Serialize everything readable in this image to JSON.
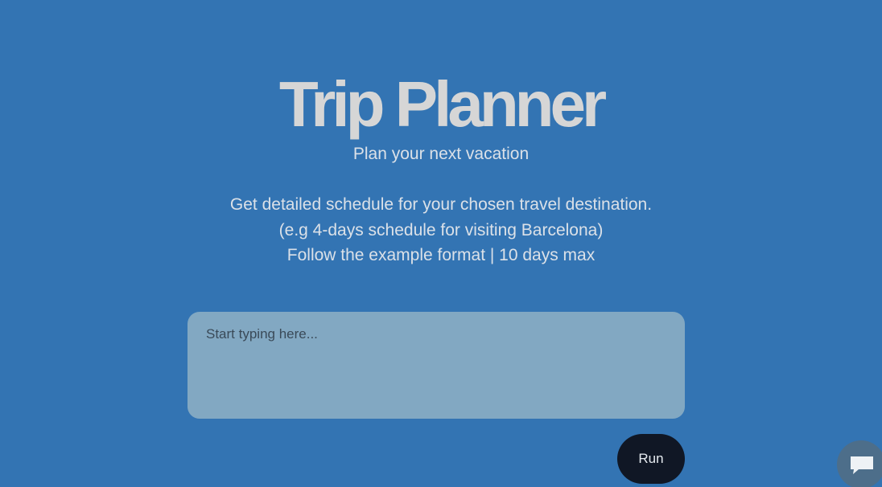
{
  "header": {
    "title": "Trip Planner",
    "subtitle": "Plan your next vacation"
  },
  "description": {
    "lines": [
      "Get detailed schedule for your chosen travel destination.",
      "(e.g 4-days schedule for visiting Barcelona)",
      "Follow the example format | 10 days max"
    ]
  },
  "prompt": {
    "placeholder": "Start typing here...",
    "value": ""
  },
  "actions": {
    "run_label": "Run"
  },
  "widget": {
    "icon": "chat-bubble-icon"
  },
  "colors": {
    "background": "#3374b3",
    "title": "#d6d6d6",
    "textarea": "#82a8c2",
    "button": "#101725",
    "widget": "#4d6e8a"
  }
}
